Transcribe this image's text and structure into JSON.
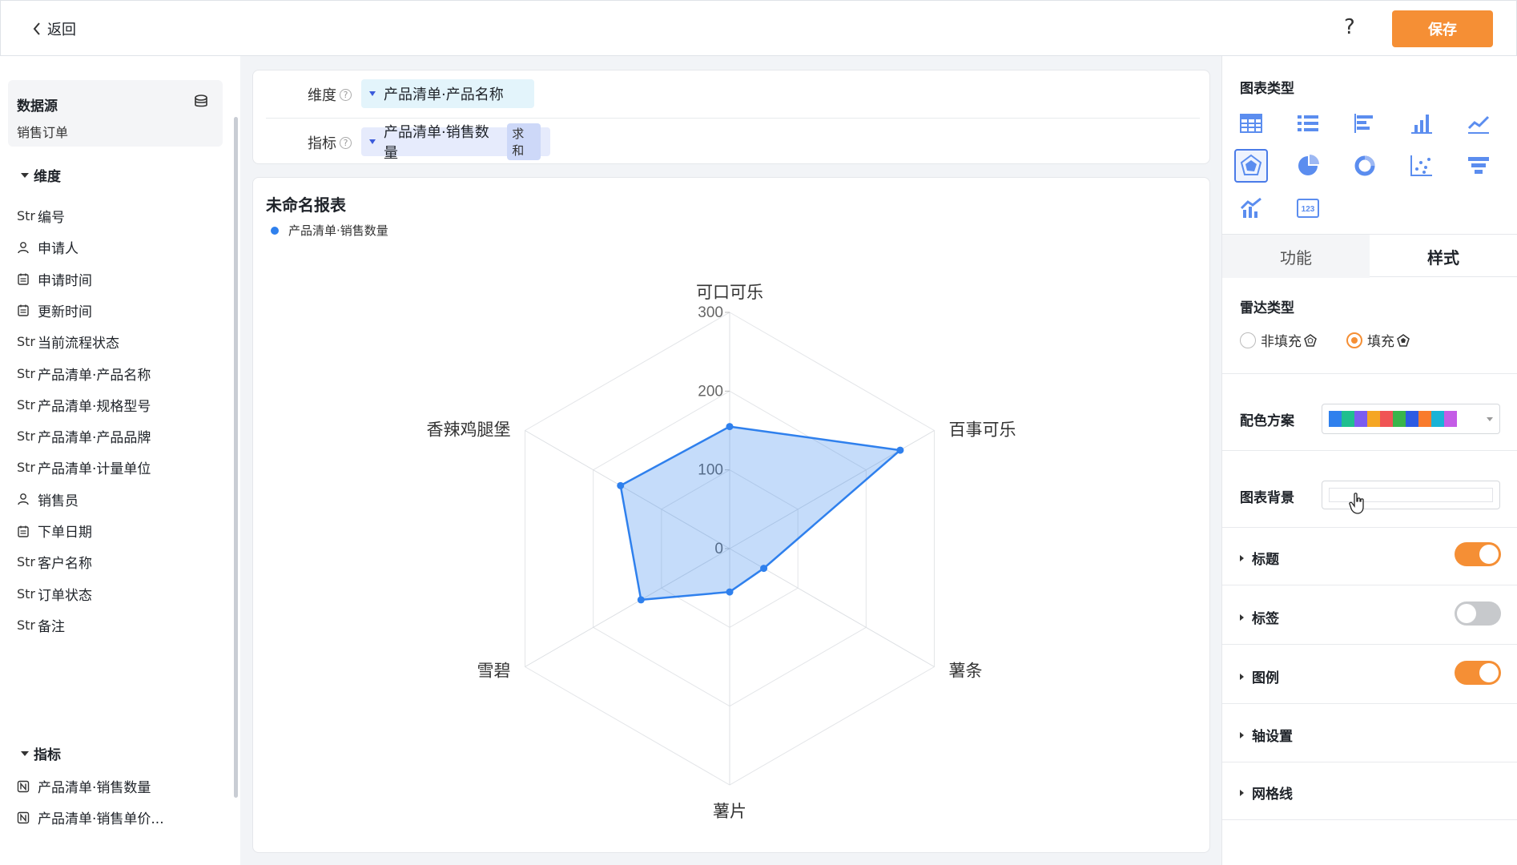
{
  "header": {
    "back_label": "返回",
    "help_label": "?",
    "save_label": "保存"
  },
  "sidebar": {
    "datasource_title": "数据源",
    "datasource_name": "销售订单",
    "dimensions_title": "维度",
    "dimension_fields": [
      {
        "type": "Str",
        "label": "编号"
      },
      {
        "type": "user-icon",
        "label": "申请人"
      },
      {
        "type": "calendar-icon",
        "label": "申请时间"
      },
      {
        "type": "calendar-icon",
        "label": "更新时间"
      },
      {
        "type": "Str",
        "label": "当前流程状态"
      },
      {
        "type": "Str",
        "label": "产品清单·产品名称"
      },
      {
        "type": "Str",
        "label": "产品清单·规格型号"
      },
      {
        "type": "Str",
        "label": "产品清单·产品品牌"
      },
      {
        "type": "Str",
        "label": "产品清单·计量单位"
      },
      {
        "type": "user-icon",
        "label": "销售员"
      },
      {
        "type": "calendar-icon",
        "label": "下单日期"
      },
      {
        "type": "Str",
        "label": "客户名称"
      },
      {
        "type": "Str",
        "label": "订单状态"
      },
      {
        "type": "Str",
        "label": "备注"
      }
    ],
    "metrics_title": "指标",
    "metric_fields": [
      {
        "type": "number-icon",
        "label": "产品清单·销售数量"
      },
      {
        "type": "number-icon",
        "label": "产品清单·销售单价..."
      }
    ]
  },
  "config": {
    "dimension_label": "维度",
    "dimension_value": "产品清单·产品名称",
    "metric_label": "指标",
    "metric_value": "产品清单·销售数量",
    "metric_agg": "求和"
  },
  "chart_data": {
    "type": "radar",
    "title": "未命名报表",
    "legend": "产品清单·销售数量",
    "legend_position": "top-left",
    "categories": [
      "可口可乐",
      "百事可乐",
      "薯条",
      "薯片",
      "雪碧",
      "香辣鸡腿堡"
    ],
    "series": [
      {
        "name": "产品清单·销售数量",
        "values": [
          155,
          250,
          50,
          55,
          130,
          160
        ]
      }
    ],
    "radial_ticks": [
      "0",
      "100",
      "200",
      "300"
    ],
    "range": [
      0,
      300
    ],
    "fill": "filled",
    "color": "#2f80ed"
  },
  "panel": {
    "chart_type_title": "图表类型",
    "chart_types": [
      "table-icon",
      "list-icon",
      "bar-horizontal-icon",
      "bar-chart-icon",
      "line-chart-icon",
      "radar-icon",
      "pie-chart-icon",
      "donut-chart-icon",
      "scatter-icon",
      "funnel-icon",
      "combo-chart-icon",
      "number-card-icon"
    ],
    "selected_chart_type": "radar-icon",
    "tab_function": "功能",
    "tab_style": "样式",
    "radar_type_title": "雷达类型",
    "radar_unfilled": "非填充",
    "radar_filled": "填充",
    "color_scheme_label": "配色方案",
    "palette": [
      "#2f80ed",
      "#1fbf8f",
      "#7b5cf0",
      "#f5a623",
      "#f05454",
      "#39b54a",
      "#2d5be3",
      "#f97b2c",
      "#19b3d6",
      "#c45ce6"
    ],
    "chart_bg_label": "图表背景",
    "sections": [
      {
        "label": "标题",
        "toggle": true
      },
      {
        "label": "标签",
        "toggle": false
      },
      {
        "label": "图例",
        "toggle": true
      },
      {
        "label": "轴设置"
      },
      {
        "label": "网格线"
      }
    ]
  }
}
